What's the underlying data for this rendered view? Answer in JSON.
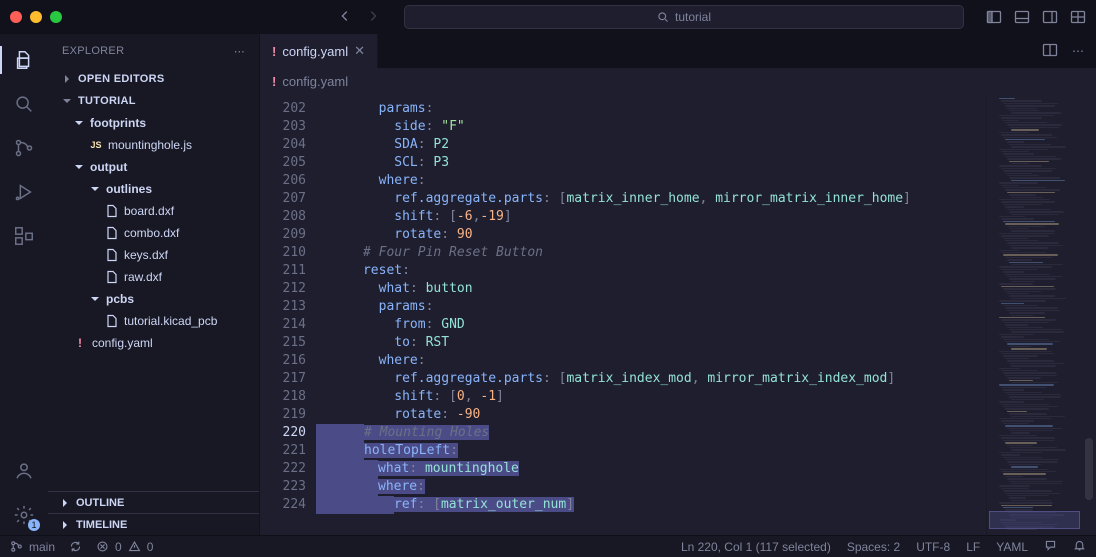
{
  "titlebar": {
    "search_value": "tutorial"
  },
  "sidebar": {
    "title": "EXPLORER",
    "sections": {
      "open_editors": "OPEN EDITORS",
      "workspace": "TUTORIAL",
      "outline": "OUTLINE",
      "timeline": "TIMELINE"
    },
    "tree": {
      "footprints": "footprints",
      "mountinghole": "mountinghole.js",
      "output": "output",
      "outlines": "outlines",
      "board": "board.dxf",
      "combo": "combo.dxf",
      "keys": "keys.dxf",
      "raw": "raw.dxf",
      "pcbs": "pcbs",
      "tutorial_pcb": "tutorial.kicad_pcb",
      "config": "config.yaml"
    }
  },
  "tab": {
    "label": "config.yaml"
  },
  "breadcrumb": {
    "label": "config.yaml"
  },
  "gutter": {
    "start": 202,
    "end": 224,
    "current": 220
  },
  "code": {
    "l202": {
      "k": "params"
    },
    "l203": {
      "k": "side",
      "v": "\"F\""
    },
    "l204": {
      "k": "SDA",
      "v": "P2"
    },
    "l205": {
      "k": "SCL",
      "v": "P3"
    },
    "l206": {
      "k": "where"
    },
    "l207": {
      "k": "ref.aggregate.parts",
      "a": "matrix_inner_home",
      "b": "mirror_matrix_inner_home"
    },
    "l208": {
      "k": "shift",
      "a": "-6",
      "b": "-19"
    },
    "l209": {
      "k": "rotate",
      "v": "90"
    },
    "l210": {
      "c": "# Four Pin Reset Button"
    },
    "l211": {
      "k": "reset"
    },
    "l212": {
      "k": "what",
      "v": "button"
    },
    "l213": {
      "k": "params"
    },
    "l214": {
      "k": "from",
      "v": "GND"
    },
    "l215": {
      "k": "to",
      "v": "RST"
    },
    "l216": {
      "k": "where"
    },
    "l217": {
      "k": "ref.aggregate.parts",
      "a": "matrix_index_mod",
      "b": "mirror_matrix_index_mod"
    },
    "l218": {
      "k": "shift",
      "a": "0",
      "b": "-1"
    },
    "l219": {
      "k": "rotate",
      "v": "-90"
    },
    "l220": {
      "c": "# Mounting Holes"
    },
    "l221": {
      "k": "holeTopLeft"
    },
    "l222": {
      "k": "what",
      "v": "mountinghole"
    },
    "l223": {
      "k": "where"
    },
    "l224": {
      "k": "ref",
      "a": "matrix_outer_num"
    }
  },
  "status": {
    "branch": "main",
    "errors": "0",
    "warnings": "0",
    "cursor": "Ln 220, Col 1 (117 selected)",
    "spaces": "Spaces: 2",
    "encoding": "UTF-8",
    "eol": "LF",
    "lang": "YAML"
  },
  "activity": {
    "settings_badge": "1"
  }
}
